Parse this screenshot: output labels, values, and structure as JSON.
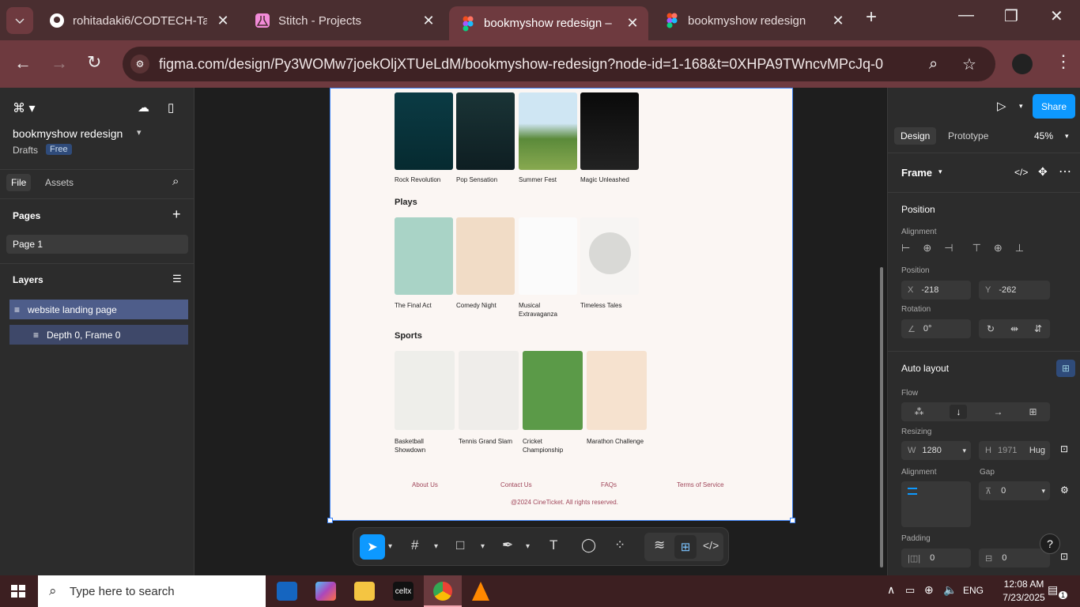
{
  "browser": {
    "tabs": [
      {
        "title": "rohitadaki6/CODTECH-Ta",
        "icon": "github-icon"
      },
      {
        "title": "Stitch - Projects",
        "icon": "flask-icon"
      },
      {
        "title": "bookmyshow redesign –",
        "icon": "figma-icon"
      },
      {
        "title": "bookmyshow redesign",
        "icon": "figma-icon"
      }
    ],
    "url": "figma.com/design/Py3WOMw7joekOljXTUeLdM/bookmyshow-redesign?node-id=1-168&t=0XHPA9TWncvMPcJq-0"
  },
  "left_panel": {
    "file_name": "bookmyshow redesign",
    "location": "Drafts",
    "plan": "Free",
    "tab_file": "File",
    "tab_assets": "Assets",
    "pages_heading": "Pages",
    "page1": "Page 1",
    "layers_heading": "Layers",
    "layer1": "website landing page",
    "layer2": "Depth 0, Frame 0"
  },
  "right_panel": {
    "tab_design": "Design",
    "tab_prototype": "Prototype",
    "zoom": "45%",
    "share": "Share",
    "frame_label": "Frame",
    "position_heading": "Position",
    "alignment_label": "Alignment",
    "position_label": "Position",
    "x_label": "X",
    "x_value": "-218",
    "y_label": "Y",
    "y_value": "-262",
    "rotation_label": "Rotation",
    "rotation_value": "0°",
    "auto_layout_heading": "Auto layout",
    "flow_label": "Flow",
    "resizing_label": "Resizing",
    "w_label": "W",
    "w_value": "1280",
    "h_label": "H",
    "h_value": "1971",
    "h_mode": "Hug",
    "alignment2_label": "Alignment",
    "gap_label": "Gap",
    "gap_value": "0",
    "padding_label": "Padding",
    "padding_h": "0",
    "padding_v": "0"
  },
  "design": {
    "top_row": [
      "Rock Revolution",
      "Pop Sensation",
      "Summer Fest",
      "Magic Unleashed"
    ],
    "plays_heading": "Plays",
    "plays": [
      "The Final Act",
      "Comedy Night",
      "Musical Extravaganza",
      "Timeless Tales"
    ],
    "sports_heading": "Sports",
    "sports": [
      "Basketball Showdown",
      "Tennis Grand Slam",
      "Cricket Championship",
      "Marathon Challenge"
    ],
    "footer_links": [
      "About Us",
      "Contact Us",
      "FAQs",
      "Terms of Service"
    ],
    "copyright": "@2024 CineTicket. All rights reserved."
  },
  "taskbar": {
    "search_placeholder": "Type here to search",
    "lang": "ENG",
    "time": "12:08 AM",
    "date": "7/23/2025",
    "notif_count": "1"
  },
  "colors": {
    "accent": "#0d99ff",
    "footer_link": "#a0465a",
    "chrome_bg": "#4a2e30"
  }
}
